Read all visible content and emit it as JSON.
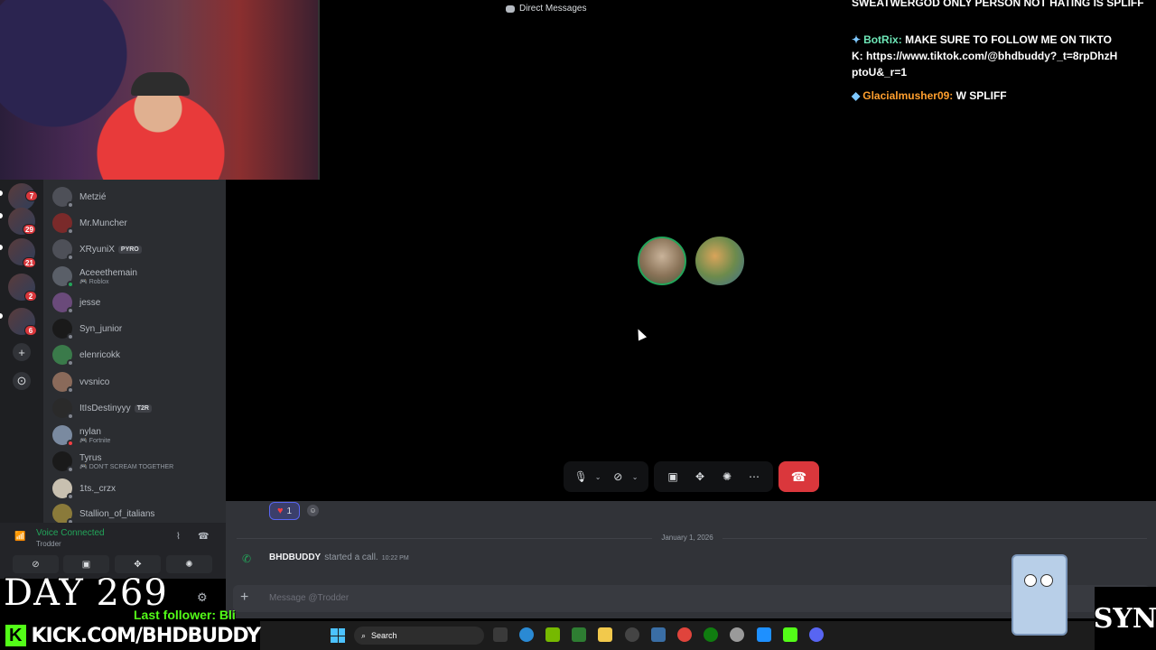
{
  "window": {
    "title": "Direct Messages"
  },
  "stream_chat": [
    {
      "text": "SWEATWERGOD ONLY PERSON NOT HATING IS SPLIFF"
    },
    {
      "user": "BotRix:",
      "text": "MAKE SURE TO FOLLOW ME ON TIKTOK: https://www.tiktok.com/@bhdbuddy?_t=8rpDhzHptoU&_r=1"
    },
    {
      "user": "Glacialmusher09:",
      "text": "W SPLIFF"
    }
  ],
  "servers": [
    {
      "badge": "7"
    },
    {
      "badge": "29"
    },
    {
      "badge": "21"
    },
    {
      "badge": "2"
    },
    {
      "badge": "6"
    }
  ],
  "rail": {
    "add_icon": "+",
    "discover_icon": "⊙"
  },
  "dm_list": [
    {
      "name": "Metzié",
      "sub": "",
      "tag": ""
    },
    {
      "name": "Mr.Muncher",
      "sub": "",
      "tag": ""
    },
    {
      "name": "XRyuniX",
      "sub": "",
      "tag": "PYRO"
    },
    {
      "name": "Aceeethemain",
      "sub": "Roblox",
      "tag": ""
    },
    {
      "name": "jesse",
      "sub": "",
      "tag": ""
    },
    {
      "name": "Syn_junior",
      "sub": "",
      "tag": ""
    },
    {
      "name": "elenricokk",
      "sub": "",
      "tag": ""
    },
    {
      "name": "vvsnico",
      "sub": "",
      "tag": ""
    },
    {
      "name": "ItIsDestinyyy",
      "sub": "",
      "tag": "T2R"
    },
    {
      "name": "nylan",
      "sub": "Fortnite",
      "tag": ""
    },
    {
      "name": "Tyrus",
      "sub": "DON'T SCREAM TOGETHER",
      "tag": ""
    },
    {
      "name": "1ts._crzx",
      "sub": "",
      "tag": ""
    },
    {
      "name": "Stallion_of_italians",
      "sub": "",
      "tag": ""
    }
  ],
  "voice": {
    "label": "Voice Connected",
    "channel": "Trodder"
  },
  "reaction": {
    "count": "1"
  },
  "chat": {
    "date": "January 1, 2026",
    "call_user": "BHDBUDDY",
    "call_text": "started a call.",
    "call_time": "10:22 PM",
    "placeholder": "Message @Trodder"
  },
  "taskbar": {
    "search": "Search"
  },
  "overlay": {
    "day": "DAY 269",
    "last_follower": "Last follower: Bli",
    "kick_url": "KICK.COM/BHDBUDDY",
    "logo_text": "SYN"
  },
  "colors": {
    "accent_green": "#23a55a",
    "hangup_red": "#da373c",
    "kick_green": "#53fc18"
  }
}
